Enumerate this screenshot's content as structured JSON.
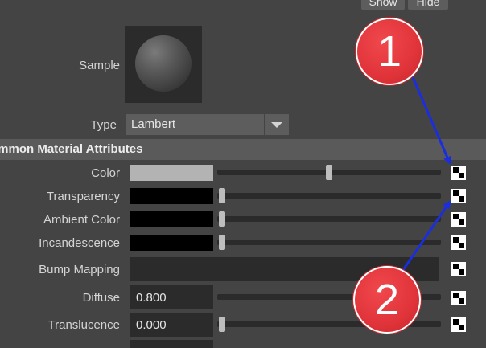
{
  "top_buttons": {
    "show": "Show",
    "hide": "Hide"
  },
  "sample_label": "Sample",
  "type_label": "Type",
  "type_value": "Lambert",
  "section_title": "ommon Material Attributes",
  "rows": {
    "color": {
      "label": "Color",
      "swatch": "#b3b3b3",
      "slider": 0.5
    },
    "transparency": {
      "label": "Transparency",
      "swatch": "#000000",
      "slider": 0
    },
    "ambient": {
      "label": "Ambient Color",
      "swatch": "#000000",
      "slider": 0
    },
    "incandescence": {
      "label": "Incandescence",
      "swatch": "#000000",
      "slider": 0
    },
    "bump": {
      "label": "Bump Mapping"
    },
    "diffuse": {
      "label": "Diffuse",
      "value": "0.800",
      "slider": 0.8
    },
    "translucence": {
      "label": "Translucence",
      "value": "0.000",
      "slider": 0
    }
  },
  "callouts": {
    "one": "1",
    "two": "2"
  },
  "colors": {
    "arrow": "#1a2ee0",
    "callout": "#e0343a"
  },
  "icons": {
    "map_button": "checker-map-icon"
  }
}
